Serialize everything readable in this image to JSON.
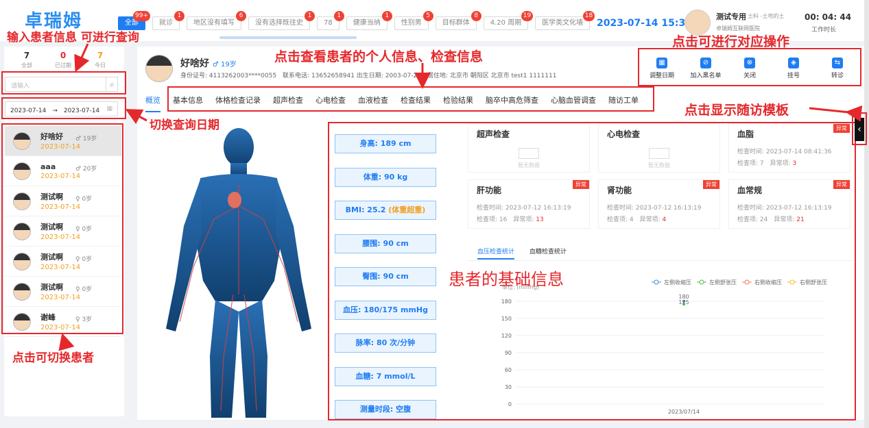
{
  "app": {
    "logo": "卓瑞姆"
  },
  "top_tabs": [
    {
      "label": "全部",
      "badge": "99+",
      "active": true
    },
    {
      "label": "就诊",
      "badge": "1"
    },
    {
      "label": "地区没有填写",
      "badge": "6"
    },
    {
      "label": "没有选择既往史",
      "badge": "1"
    },
    {
      "label": "78",
      "badge": "1"
    },
    {
      "label": "健康当纳",
      "badge": "1"
    },
    {
      "label": "性别男",
      "badge": "5"
    },
    {
      "label": "目标群体",
      "badge": "8"
    },
    {
      "label": "4.20 周期",
      "badge": "19"
    },
    {
      "label": "医学类文化墙",
      "badge": "18"
    }
  ],
  "header": {
    "datetime": "2023-07-14 15:32",
    "doctor_name": "测试专用",
    "doctor_sub": "土料 -土地的土",
    "hospital": "卓瑞姆互联网医院",
    "timer": "00: 04: 44",
    "timer_label": "工作时长"
  },
  "sidebar": {
    "stats": [
      {
        "num": "7",
        "label": "全部",
        "color": "#333"
      },
      {
        "num": "0",
        "label": "已过期",
        "color": "#e5282c"
      },
      {
        "num": "7",
        "label": "今日",
        "color": "#f0a020"
      }
    ],
    "search_placeholder": "请输入",
    "date_start": "2023-07-14",
    "date_end": "2023-07-14",
    "patients": [
      {
        "name": "好啥好",
        "age": "♂ 19岁",
        "date": "2023-07-14"
      },
      {
        "name": "aaa",
        "age": "♂ 20岁",
        "date": "2023-07-14"
      },
      {
        "name": "测试啊",
        "age": "♀ 0岁",
        "date": "2023-07-14"
      },
      {
        "name": "测试啊",
        "age": "♀ 0岁",
        "date": "2023-07-14"
      },
      {
        "name": "测试啊",
        "age": "♀ 0岁",
        "date": "2023-07-14"
      },
      {
        "name": "测试啊",
        "age": "♀ 0岁",
        "date": "2023-07-14"
      },
      {
        "name": "谢峰",
        "age": "♀ 3岁",
        "date": "2023-07-14"
      }
    ]
  },
  "patient": {
    "name": "好啥好",
    "gender_age": "♂ 19岁",
    "meta": "身份证号: 4113262003****0055　联系电话: 13652658941 出生日期: 2003-07-23　居住地: 北京市 朝阳区 北京市 test1 1111111"
  },
  "actions": [
    {
      "label": "调整日期",
      "icon": "calendar-icon",
      "glyph": "▦"
    },
    {
      "label": "加入黑名单",
      "icon": "blacklist-icon",
      "glyph": "⊘"
    },
    {
      "label": "关闭",
      "icon": "close-icon",
      "glyph": "⊗"
    },
    {
      "label": "挂号",
      "icon": "register-icon",
      "glyph": "◈"
    },
    {
      "label": "转诊",
      "icon": "referral-icon",
      "glyph": "⇆"
    }
  ],
  "nav_tabs": [
    "概览",
    "基本信息",
    "体格检查记录",
    "超声检查",
    "心电检查",
    "血液检查",
    "检查结果",
    "检验结果",
    "脑卒中高危筛查",
    "心脑血管调查",
    "随访工单"
  ],
  "metrics": [
    "身高: 189 cm",
    "体重: 90 kg",
    "BMI: 25.2",
    "腰围: 90 cm",
    "臀围: 90 cm",
    "血压: 180/175 mmHg",
    "脉率: 80 次/分钟",
    "血糖: 7 mmol/L",
    "测量时段: 空腹"
  ],
  "bmi_note": "(体重超重)",
  "cards": [
    {
      "title": "超声检查",
      "nodata": "暂无数据"
    },
    {
      "title": "心电检查",
      "nodata": "暂无数据"
    },
    {
      "title": "血脂",
      "abnormal": "异常",
      "time": "检查时间: 2023-07-14 08:41:36",
      "items": "检查项: 7　异常项:",
      "abn_count": "3"
    },
    {
      "title": "肝功能",
      "abnormal": "异常",
      "time": "检查时间: 2023-07-12 16:13:19",
      "items": "检查项: 16　异常项:",
      "abn_count": "13"
    },
    {
      "title": "肾功能",
      "abnormal": "异常",
      "time": "检查时间: 2023-07-12 16:13:19",
      "items": "检查项: 4　异常项:",
      "abn_count": "4"
    },
    {
      "title": "血常规",
      "abnormal": "异常",
      "time": "检查时间: 2023-07-12 16:13:19",
      "items": "检查项: 24　异常项:",
      "abn_count": "21"
    }
  ],
  "chart_tabs": [
    "血压检查统计",
    "血糖检查统计"
  ],
  "chart_data": {
    "type": "line",
    "ylabel": "单位: (mmHg)",
    "ylim": [
      0,
      180
    ],
    "yticks": [
      0,
      30,
      60,
      90,
      120,
      150,
      180
    ],
    "categories": [
      "2023/07/14"
    ],
    "series": [
      {
        "name": "左侧收缩压",
        "values": [
          180
        ],
        "color": "#3b8fdc"
      },
      {
        "name": "左侧舒张压",
        "values": [
          175
        ],
        "color": "#4cb848"
      },
      {
        "name": "右侧收缩压",
        "values": [
          null
        ],
        "color": "#f07850"
      },
      {
        "name": "右侧舒张压",
        "values": [
          null
        ],
        "color": "#f0c020"
      }
    ],
    "point_labels": [
      "180",
      "175"
    ]
  },
  "annotations": {
    "a1": "输入患者信息 可进行查询",
    "a2": "点击查看患者的个人信息、检查信息",
    "a3": "点击可进行对应操作",
    "a4": "点击显示随访模板",
    "a5": "切换查询日期",
    "a6": "患者的基础信息",
    "a7": "点击可切换患者"
  }
}
